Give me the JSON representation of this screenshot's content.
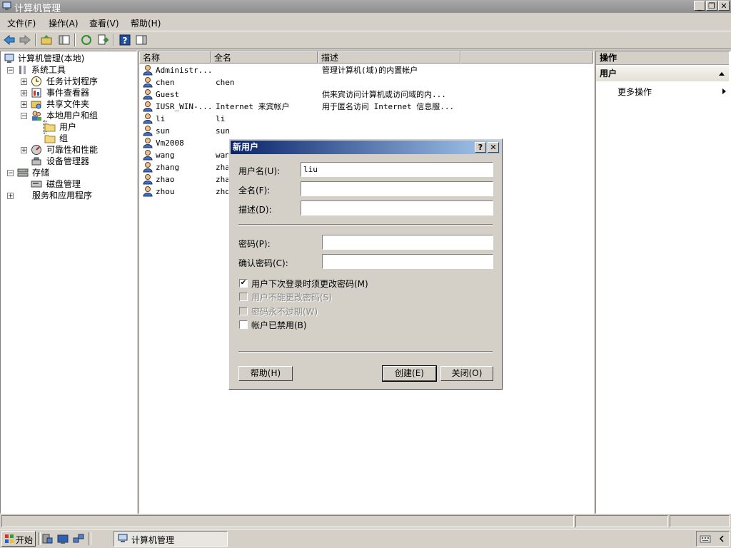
{
  "window": {
    "title": "计算机管理",
    "min_label": "_",
    "restore_label": "❐",
    "close_label": "✕"
  },
  "menu": [
    "文件(F)",
    "操作(A)",
    "查看(V)",
    "帮助(H)"
  ],
  "tree": [
    {
      "label": "计算机管理(本地)",
      "icon": "computer-icon",
      "expander": ""
    },
    {
      "label": "系统工具",
      "icon": "tools-icon",
      "expander": "−"
    },
    {
      "label": "任务计划程序",
      "icon": "clock-icon",
      "expander": "+"
    },
    {
      "label": "事件查看器",
      "icon": "event-viewer-icon",
      "expander": "+"
    },
    {
      "label": "共享文件夹",
      "icon": "shared-folder-icon",
      "expander": "+"
    },
    {
      "label": "本地用户和组",
      "icon": "users-group-icon",
      "expander": "−"
    },
    {
      "label": "用户",
      "icon": "folder-icon",
      "expander": ""
    },
    {
      "label": "组",
      "icon": "folder-icon",
      "expander": ""
    },
    {
      "label": "可靠性和性能",
      "icon": "performance-icon",
      "expander": "+"
    },
    {
      "label": "设备管理器",
      "icon": "device-manager-icon",
      "expander": ""
    },
    {
      "label": "存储",
      "icon": "storage-icon",
      "expander": "−"
    },
    {
      "label": "磁盘管理",
      "icon": "disk-icon",
      "expander": ""
    },
    {
      "label": "服务和应用程序",
      "icon": "services-icon",
      "expander": "+"
    }
  ],
  "list": {
    "columns": [
      "名称",
      "全名",
      "描述"
    ],
    "rows": [
      {
        "name": "Administr...",
        "fullname": "",
        "desc": "管理计算机(域)的内置帐户"
      },
      {
        "name": "chen",
        "fullname": "chen",
        "desc": ""
      },
      {
        "name": "Guest",
        "fullname": "",
        "desc": "供来宾访问计算机或访问域的内..."
      },
      {
        "name": "IUSR_WIN-...",
        "fullname": "Internet 来宾帐户",
        "desc": "用于匿名访问 Internet 信息服..."
      },
      {
        "name": "li",
        "fullname": "li",
        "desc": ""
      },
      {
        "name": "sun",
        "fullname": "sun",
        "desc": ""
      },
      {
        "name": "Vm2008",
        "fullname": "",
        "desc": ""
      },
      {
        "name": "wang",
        "fullname": "wan",
        "desc": ""
      },
      {
        "name": "zhang",
        "fullname": "zha",
        "desc": ""
      },
      {
        "name": "zhao",
        "fullname": "zha",
        "desc": ""
      },
      {
        "name": "zhou",
        "fullname": "zho",
        "desc": ""
      }
    ]
  },
  "actions": {
    "header": "操作",
    "section": "用户",
    "more": "更多操作"
  },
  "dialog": {
    "title": "新用户",
    "help_btn": "?",
    "close_btn": "✕",
    "username_label": "用户名(U):",
    "username_value": "liu",
    "fullname_label": "全名(F):",
    "fullname_value": "",
    "description_label": "描述(D):",
    "description_value": "",
    "password_label": "密码(P):",
    "confirm_label": "确认密码(C):",
    "checkboxes": [
      {
        "label": "用户下次登录时须更改密码(M)",
        "checked": true,
        "enabled": true
      },
      {
        "label": "用户不能更改密码(S)",
        "checked": false,
        "enabled": false
      },
      {
        "label": "密码永不过期(W)",
        "checked": false,
        "enabled": false
      },
      {
        "label": "帐户已禁用(B)",
        "checked": false,
        "enabled": true
      }
    ],
    "help_button": "帮助(H)",
    "create_button": "创建(E)",
    "close_button": "关闭(O)"
  },
  "taskbar": {
    "start": "开始",
    "task": "计算机管理"
  },
  "colors": {
    "accent": "#0a246a",
    "accent_end": "#a6caf0",
    "face": "#d4d0c8"
  }
}
